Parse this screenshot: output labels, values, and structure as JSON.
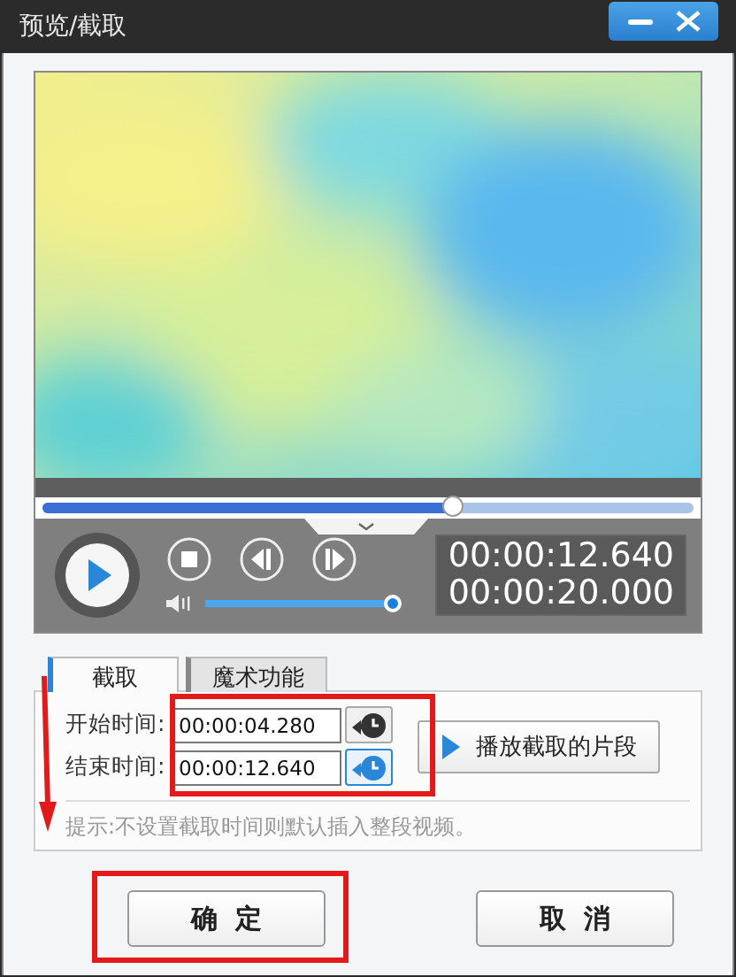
{
  "window": {
    "title": "预览/截取"
  },
  "player": {
    "seek": {
      "level": 0.63
    },
    "volume": {
      "level": 0.98
    },
    "current_time": "00:00:12.640",
    "total_time": "00:00:20.000"
  },
  "tabs": [
    {
      "label": "截取",
      "selected": true
    },
    {
      "label": "魔术功能",
      "selected": false
    }
  ],
  "trim": {
    "fields": [
      {
        "label": "开始时间:",
        "value": "00:00:04.280",
        "highlighted": false
      },
      {
        "label": "结束时间:",
        "value": "00:00:12.640",
        "highlighted": true
      }
    ],
    "play_segment_button": "播放截取的片段",
    "hint": "提示:不设置截取时间则默认插入整段视频。"
  },
  "buttons": [
    {
      "label": "确  定"
    },
    {
      "label": "取  消"
    }
  ]
}
